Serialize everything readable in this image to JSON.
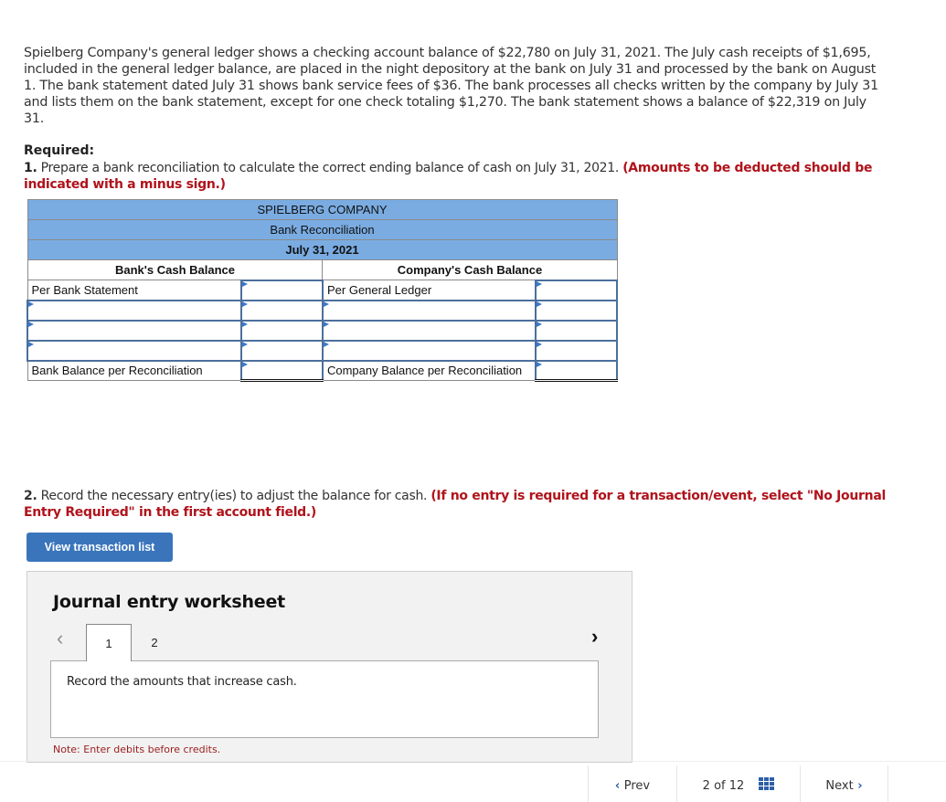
{
  "problem_text": "Spielberg Company's general ledger shows a checking account balance of $22,780 on July 31, 2021. The July cash receipts of $1,695, included in the general ledger balance, are placed in the night depository at the bank on July 31 and processed by the bank on August 1. The bank statement dated July 31 shows bank service fees of $36. The bank processes all checks written by the company by July 31 and lists them on the bank statement, except for one check totaling $1,270. The bank statement shows a balance of $22,319 on July 31.",
  "required": {
    "heading": "Required:",
    "part1_number": "1.",
    "part1_text": " Prepare a bank reconciliation to calculate the correct ending balance of cash on July 31, 2021. ",
    "part1_note": "(Amounts to be deducted should be indicated with a minus sign.)",
    "part2_number": "2.",
    "part2_text": " Record the necessary entry(ies) to adjust the balance for cash. ",
    "part2_note": "(If no entry is required for a transaction/event, select \"No Journal Entry Required\" in the first account field.)"
  },
  "reconciliation": {
    "company": "SPIELBERG COMPANY",
    "title": "Bank Reconciliation",
    "date": "July 31, 2021",
    "bank_header": "Bank's Cash Balance",
    "company_header": "Company's Cash Balance",
    "bank_rows": [
      {
        "label": "Per Bank Statement",
        "value": ""
      },
      {
        "label": "",
        "value": ""
      },
      {
        "label": "",
        "value": ""
      },
      {
        "label": "",
        "value": ""
      },
      {
        "label": "Bank Balance per Reconciliation",
        "value": ""
      }
    ],
    "company_rows": [
      {
        "label": "Per General Ledger",
        "value": ""
      },
      {
        "label": "",
        "value": ""
      },
      {
        "label": "",
        "value": ""
      },
      {
        "label": "",
        "value": ""
      },
      {
        "label": "Company Balance per Reconciliation",
        "value": ""
      }
    ]
  },
  "view_transaction_button": "View transaction list",
  "worksheet": {
    "title": "Journal entry worksheet",
    "tabs": [
      "1",
      "2"
    ],
    "active_tab": "1",
    "instruction": "Record the amounts that increase cash.",
    "note": "Note: Enter debits before credits."
  },
  "bottom_nav": {
    "prev": "Prev",
    "page_current": "2",
    "page_of": "of",
    "page_total": "12",
    "next": "Next"
  },
  "colors": {
    "header_blue": "#7aace2",
    "button_blue": "#3a75bc",
    "note_red": "#b0131b"
  }
}
